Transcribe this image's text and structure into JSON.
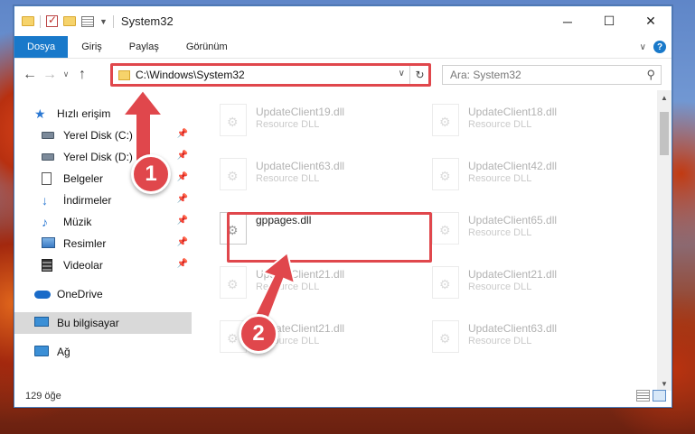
{
  "window": {
    "title": "System32",
    "controls": [
      "minimize",
      "maximize",
      "close"
    ]
  },
  "menu": {
    "tabs": [
      "Dosya",
      "Giriş",
      "Paylaş",
      "Görünüm"
    ],
    "active": "Dosya"
  },
  "address": {
    "path": "C:\\Windows\\System32",
    "refresh_icon": "↻"
  },
  "search": {
    "placeholder": "Ara: System32"
  },
  "sidebar": {
    "quick_access": "Hızlı erişim",
    "items": [
      {
        "label": "Yerel Disk (C:)",
        "icon": "disk-icon",
        "pinned": true
      },
      {
        "label": "Yerel Disk (D:)",
        "icon": "disk-icon",
        "pinned": true
      },
      {
        "label": "Belgeler",
        "icon": "document-icon",
        "pinned": true
      },
      {
        "label": "İndirmeler",
        "icon": "download-icon",
        "pinned": true
      },
      {
        "label": "Müzik",
        "icon": "music-icon",
        "pinned": true
      },
      {
        "label": "Resimler",
        "icon": "pictures-icon",
        "pinned": true
      },
      {
        "label": "Videolar",
        "icon": "video-icon",
        "pinned": true
      }
    ],
    "onedrive": "OneDrive",
    "this_pc": "Bu bilgisayar",
    "network": "Ağ"
  },
  "files": [
    {
      "name": "UpdateClient19.dll",
      "type": "Resource DLL",
      "faded": true
    },
    {
      "name": "UpdateClient18.dll",
      "type": "Resource DLL",
      "faded": true
    },
    {
      "name": "UpdateClient63.dll",
      "type": "Resource DLL",
      "faded": true
    },
    {
      "name": "UpdateClient42.dll",
      "type": "Resource DLL",
      "faded": true
    },
    {
      "name": "gppages.dll",
      "type": "",
      "faded": false
    },
    {
      "name": "UpdateClient65.dll",
      "type": "Resource DLL",
      "faded": true
    },
    {
      "name": "UpdateClient21.dll",
      "type": "Resource DLL",
      "faded": true
    },
    {
      "name": "UpdateClient21.dll",
      "type": "Resource DLL",
      "faded": true
    },
    {
      "name": "UpdateClient21.dll",
      "type": "Resource DLL",
      "faded": true
    },
    {
      "name": "UpdateClient63.dll",
      "type": "Resource DLL",
      "faded": true
    }
  ],
  "status": {
    "count": "129 öğe"
  },
  "annotations": {
    "step1": "1",
    "step2": "2",
    "color": "#e0474c"
  }
}
